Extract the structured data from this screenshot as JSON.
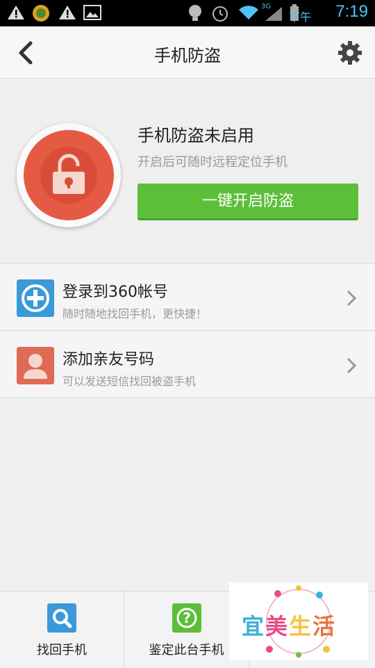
{
  "statusbar": {
    "ampm": "下午",
    "time": "7:19",
    "network_badge": "3G"
  },
  "header": {
    "title": "手机防盗"
  },
  "hero": {
    "status_title": "手机防盗未启用",
    "status_sub": "开启后可随时远程定位手机",
    "enable_label": "一键开启防盗"
  },
  "list": {
    "items": [
      {
        "title": "登录到360帐号",
        "sub": "随时随地找回手机，更快捷！"
      },
      {
        "title": "添加亲友号码",
        "sub": "可以发送短信找回被盗手机"
      }
    ]
  },
  "bottom": {
    "tabs": [
      {
        "label": "找回手机"
      },
      {
        "label": "鉴定此台手机"
      }
    ]
  },
  "logo": {
    "chars": [
      "宜",
      "美",
      "生",
      "活"
    ]
  },
  "colors": {
    "accent_green": "#5bbf3a",
    "lock_red": "#e65a43",
    "blue": "#3a9ad9",
    "red_contact": "#e06a55"
  }
}
